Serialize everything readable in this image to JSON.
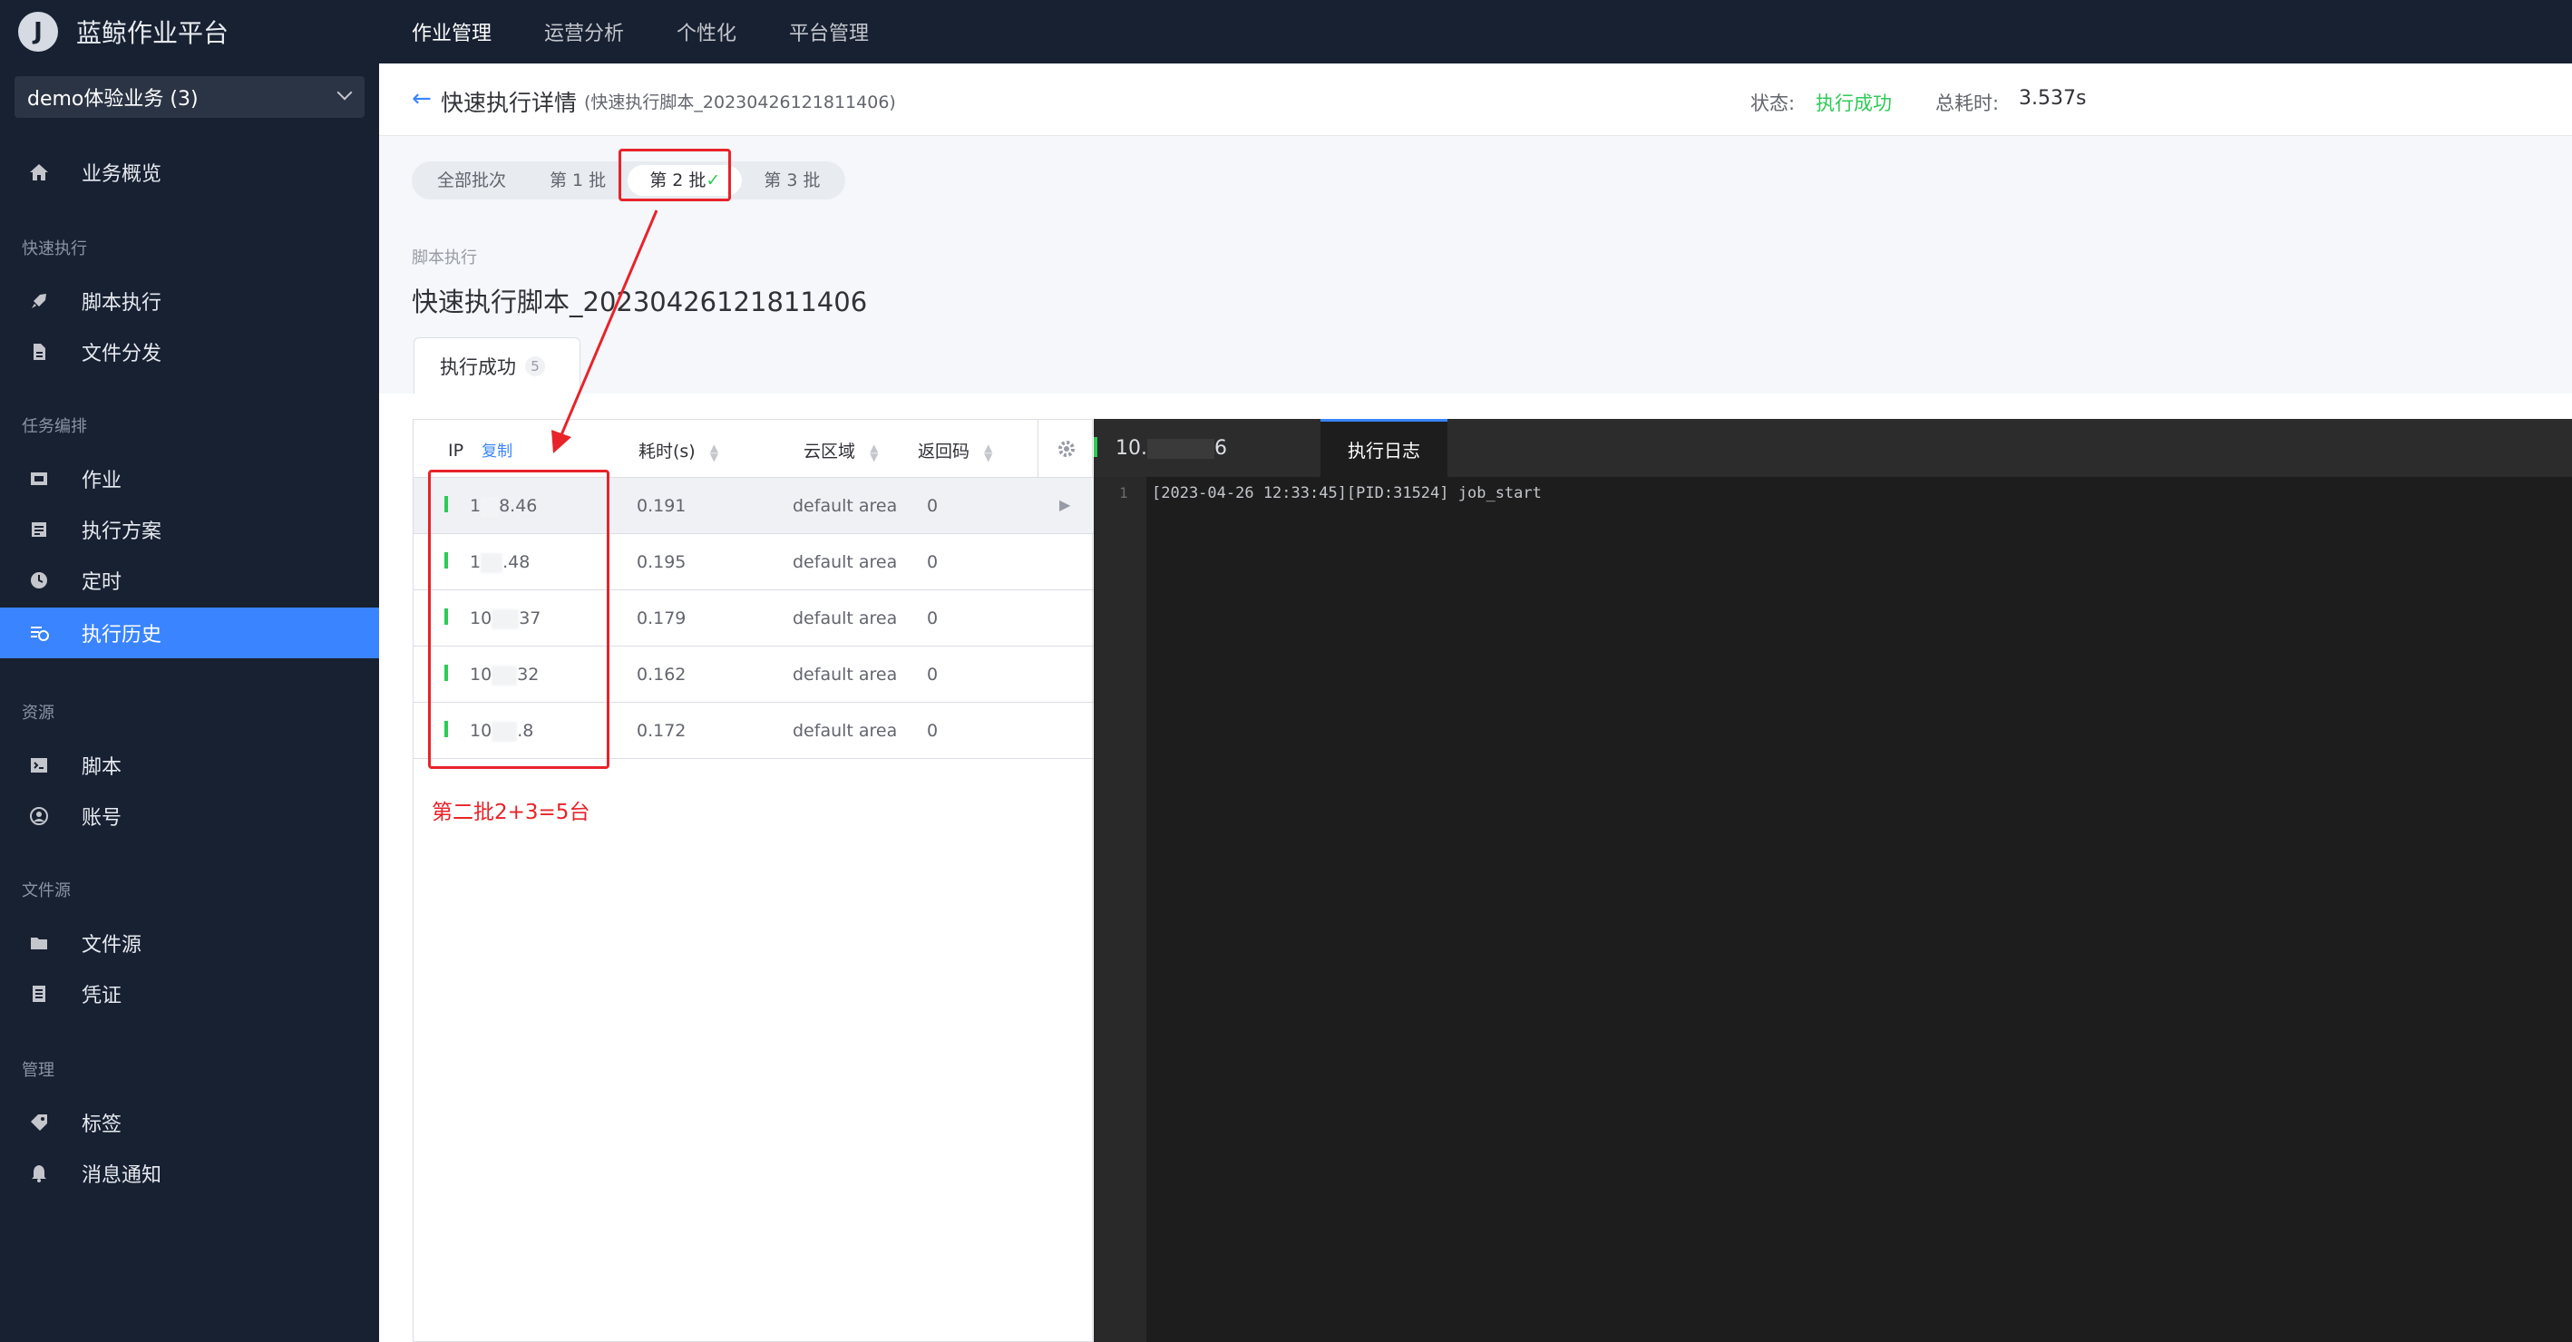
{
  "app": {
    "title": "蓝鲸作业平台",
    "logo_letter": "J"
  },
  "topnav": [
    "作业管理",
    "运营分析",
    "个性化",
    "平台管理"
  ],
  "sidebar": {
    "business": "demo体验业务 (3)",
    "overview": "业务概览",
    "groups": {
      "quick": "快速执行",
      "orchestration": "任务编排",
      "resource": "资源",
      "file_source": "文件源",
      "manage": "管理"
    },
    "items": {
      "script_exec": "脚本执行",
      "file_dist": "文件分发",
      "job": "作业",
      "plan": "执行方案",
      "cron": "定时",
      "history": "执行历史",
      "script": "脚本",
      "account": "账号",
      "file_src": "文件源",
      "ticket": "凭证",
      "tag": "标签",
      "notify": "消息通知"
    }
  },
  "header": {
    "back_icon": "←",
    "title": "快速执行详情",
    "subtitle": "(快速执行脚本_20230426121811406)",
    "status_label": "状态:",
    "status_value": "执行成功",
    "status_color": "#2dcb56",
    "time_label": "总耗时:",
    "time_value": "3.537s"
  },
  "batches": {
    "all": "全部批次",
    "b1": "第 1 批",
    "b2": "第 2 批",
    "b2_check": "✓",
    "b3": "第 3 批"
  },
  "step": {
    "type": "脚本执行",
    "name": "快速执行脚本_20230426121811406",
    "result_tab": "执行成功",
    "result_count": "5"
  },
  "table": {
    "columns": {
      "ip": "IP",
      "copy": "复制",
      "time": "耗时(s)",
      "cloud": "云区域",
      "code": "返回码"
    },
    "rows": [
      {
        "ip_pre": "1",
        "ip_suf": "8.46",
        "time": "0.191",
        "cloud": "default area",
        "code": "0"
      },
      {
        "ip_pre": "1",
        "ip_suf": ".48",
        "time": "0.195",
        "cloud": "default area",
        "code": "0"
      },
      {
        "ip_pre": "10",
        "ip_suf": "37",
        "time": "0.179",
        "cloud": "default area",
        "code": "0"
      },
      {
        "ip_pre": "10",
        "ip_suf": "32",
        "time": "0.162",
        "cloud": "default area",
        "code": "0"
      },
      {
        "ip_pre": "10",
        "ip_suf": ".8",
        "time": "0.172",
        "cloud": "default area",
        "code": "0"
      }
    ]
  },
  "annotation": "第二批2+3=5台",
  "log": {
    "host_pre": "10.",
    "host_suf": "6",
    "tab": "执行日志",
    "line_no": "1",
    "line": "[2023-04-26 12:33:45][PID:31524] job_start"
  },
  "colors": {
    "accent": "#3a84ff",
    "success": "#2dcb56",
    "annotation": "#e8232a",
    "nav_bg": "#182132"
  }
}
